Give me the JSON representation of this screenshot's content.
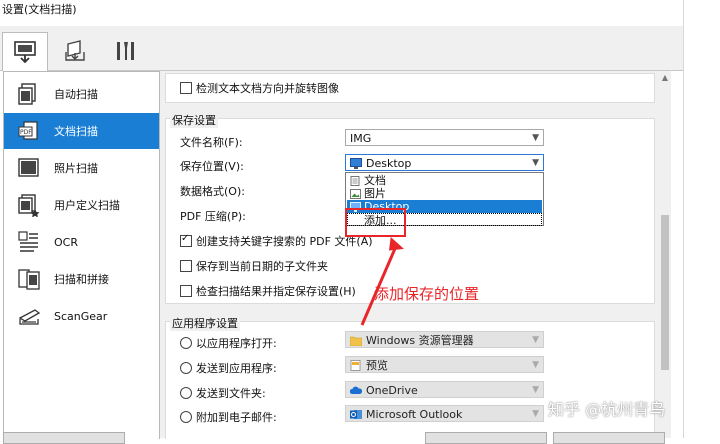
{
  "window": {
    "title": "设置(文档扫描)"
  },
  "tabs": [
    {
      "name": "scan-tab",
      "icon": "computer-scan-icon"
    },
    {
      "name": "save-tab",
      "icon": "monitor-tray-icon"
    },
    {
      "name": "tools-tab",
      "icon": "tools-icon"
    }
  ],
  "sidebar": {
    "items": [
      {
        "label": "自动扫描",
        "icon": "auto-scan-icon"
      },
      {
        "label": "文档扫描",
        "icon": "pdf-document-icon",
        "selected": true
      },
      {
        "label": "照片扫描",
        "icon": "photo-scan-icon"
      },
      {
        "label": "用户定义扫描",
        "icon": "custom-scan-icon"
      },
      {
        "label": "OCR",
        "icon": "ocr-icon"
      },
      {
        "label": "扫描和拼接",
        "icon": "stitch-icon"
      },
      {
        "label": "ScanGear",
        "icon": "scangear-icon"
      }
    ]
  },
  "options": {
    "detect_orientation": "检测文本文档方向并旋转图像"
  },
  "save_settings": {
    "title": "保存设置",
    "file_name_label": "文件名称(F):",
    "file_name_value": "IMG",
    "save_location_label": "保存位置(V):",
    "save_location_value": "Desktop",
    "data_format_label": "数据格式(O):",
    "pdf_compression_label": "PDF 压缩(P):",
    "create_pdf_label": "创建支持关键字搜索的 PDF 文件(A)",
    "subfolder_label": "保存到当前日期的子文件夹",
    "check_results_label": "检查扫描结果并指定保存设置(H)",
    "dropdown_items": [
      "文档",
      "图片",
      "Desktop",
      "添加..."
    ]
  },
  "app_settings": {
    "title": "应用程序设置",
    "open_with_label": "以应用程序打开:",
    "open_with_value": "Windows 资源管理器",
    "send_to_app_label": "发送到应用程序:",
    "send_to_app_value": "预览",
    "send_to_folder_label": "发送到文件夹:",
    "send_to_folder_value": "OneDrive",
    "attach_email_label": "附加到电子邮件:",
    "attach_email_value": "Microsoft Outlook"
  },
  "annotation": {
    "text": "添加保存的位置"
  },
  "watermark": {
    "text": "知乎 @杭州青鸟"
  },
  "colors": {
    "selection": "#1a7fd4",
    "annotation": "#e8262a"
  }
}
